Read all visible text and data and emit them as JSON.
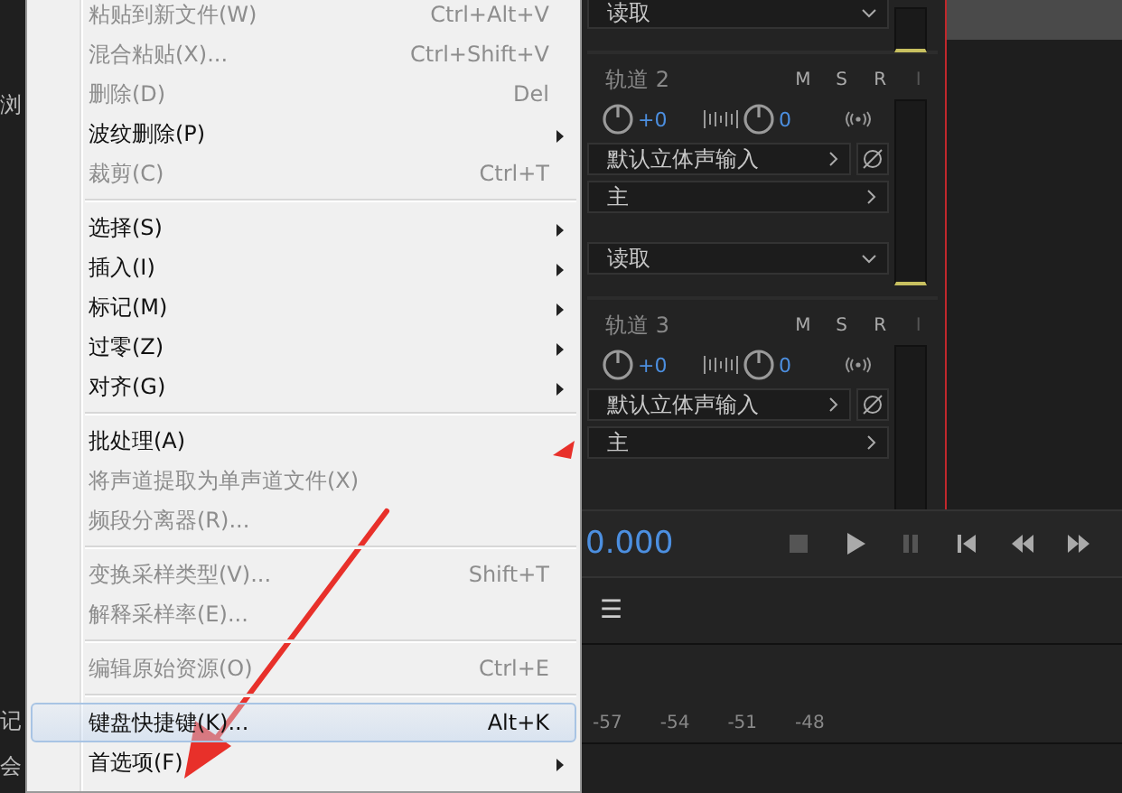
{
  "left_panel": {
    "labels": [
      "浏",
      "记",
      "会"
    ]
  },
  "menu": {
    "items": [
      {
        "kind": "item",
        "label": "粘贴到新文件(W)",
        "shortcut": "Ctrl+Alt+V",
        "disabled": true,
        "submenu": false,
        "selected": false
      },
      {
        "kind": "item",
        "label": "混合粘贴(X)...",
        "shortcut": "Ctrl+Shift+V",
        "disabled": true,
        "submenu": false,
        "selected": false
      },
      {
        "kind": "item",
        "label": "删除(D)",
        "shortcut": "Del",
        "disabled": true,
        "submenu": false,
        "selected": false
      },
      {
        "kind": "item",
        "label": "波纹删除(P)",
        "disabled": false,
        "submenu": true,
        "selected": false
      },
      {
        "kind": "item",
        "label": "裁剪(C)",
        "shortcut": "Ctrl+T",
        "disabled": true,
        "submenu": false,
        "selected": false
      },
      {
        "kind": "separator"
      },
      {
        "kind": "item",
        "label": "选择(S)",
        "disabled": false,
        "submenu": true,
        "selected": false
      },
      {
        "kind": "item",
        "label": "插入(I)",
        "disabled": false,
        "submenu": true,
        "selected": false
      },
      {
        "kind": "item",
        "label": "标记(M)",
        "disabled": false,
        "submenu": true,
        "selected": false
      },
      {
        "kind": "item",
        "label": "过零(Z)",
        "disabled": false,
        "submenu": true,
        "selected": false
      },
      {
        "kind": "item",
        "label": "对齐(G)",
        "disabled": false,
        "submenu": true,
        "selected": false
      },
      {
        "kind": "separator"
      },
      {
        "kind": "item",
        "label": "批处理(A)",
        "disabled": false,
        "submenu": false,
        "selected": false
      },
      {
        "kind": "item",
        "label": "将声道提取为单声道文件(X)",
        "disabled": true,
        "submenu": false,
        "selected": false
      },
      {
        "kind": "item",
        "label": "频段分离器(R)...",
        "disabled": true,
        "submenu": false,
        "selected": false
      },
      {
        "kind": "separator"
      },
      {
        "kind": "item",
        "label": "变换采样类型(V)...",
        "shortcut": "Shift+T",
        "disabled": true,
        "submenu": false,
        "selected": false
      },
      {
        "kind": "item",
        "label": "解释采样率(E)...",
        "disabled": true,
        "submenu": false,
        "selected": false
      },
      {
        "kind": "separator"
      },
      {
        "kind": "item",
        "label": "编辑原始资源(O)",
        "shortcut": "Ctrl+E",
        "disabled": true,
        "submenu": false,
        "selected": false
      },
      {
        "kind": "separator"
      },
      {
        "kind": "item",
        "label": "键盘快捷键(K)...",
        "shortcut": "Alt+K",
        "disabled": false,
        "submenu": false,
        "selected": true
      },
      {
        "kind": "item",
        "label": "首选项(F)",
        "disabled": false,
        "submenu": true,
        "selected": false
      }
    ]
  },
  "mixer": {
    "tracks": [
      {
        "automation": "读取"
      },
      {
        "name": "轨道 2",
        "buttons": [
          {
            "label": "M",
            "disabled": false
          },
          {
            "label": "S",
            "disabled": false
          },
          {
            "label": "R",
            "disabled": false
          },
          {
            "label": "I",
            "disabled": true
          }
        ],
        "volume": "+0",
        "pan": "0",
        "input": "默认立体声输入",
        "output": "主",
        "automation": "读取"
      },
      {
        "name": "轨道 3",
        "buttons": [
          {
            "label": "M",
            "disabled": false
          },
          {
            "label": "S",
            "disabled": false
          },
          {
            "label": "R",
            "disabled": false
          },
          {
            "label": "I",
            "disabled": true
          }
        ],
        "volume": "+0",
        "pan": "0",
        "input": "默认立体声输入",
        "output": "主"
      }
    ]
  },
  "transport": {
    "time": "0.000"
  },
  "panel_toolbar": {
    "menu_glyph": "☰"
  },
  "ruler": {
    "labels": [
      "-57",
      "-54",
      "-51",
      "-48"
    ]
  }
}
